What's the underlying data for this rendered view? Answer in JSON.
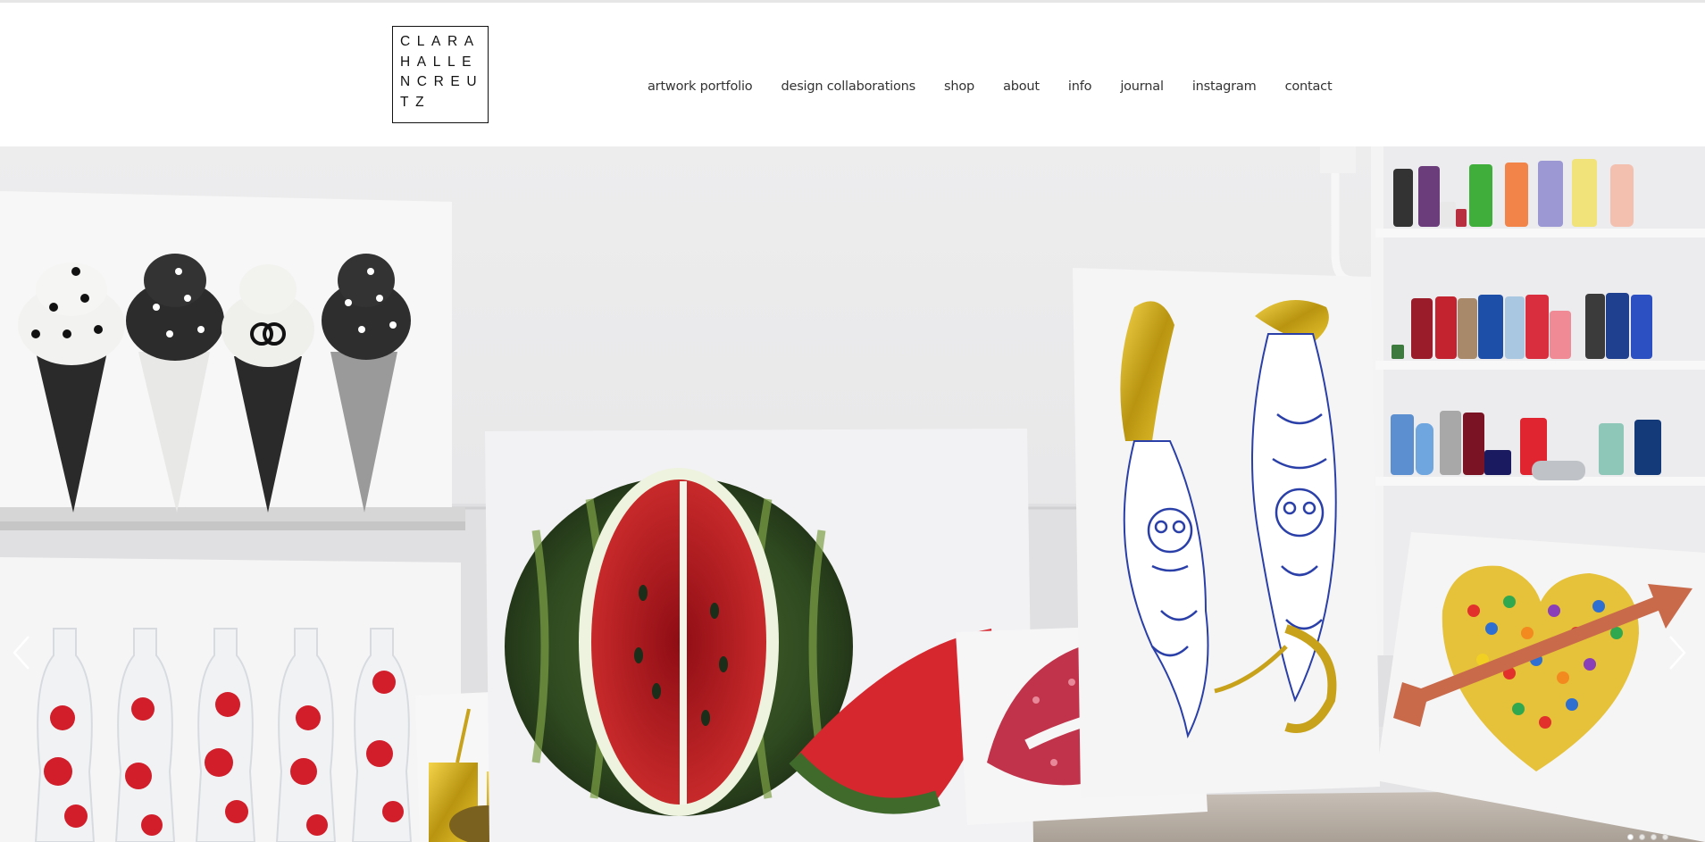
{
  "logo": {
    "lines": [
      "CLARA",
      "HALLE",
      "NCREU",
      "TZ"
    ]
  },
  "nav": {
    "items": [
      {
        "label": "artwork portfolio"
      },
      {
        "label": "design collaborations"
      },
      {
        "label": "shop"
      },
      {
        "label": "about"
      },
      {
        "label": "info"
      },
      {
        "label": "journal"
      },
      {
        "label": "instagram"
      },
      {
        "label": "contact"
      }
    ]
  },
  "slider": {
    "prev_icon": "chevron-left-icon",
    "next_icon": "chevron-right-icon",
    "current_slide": 1,
    "slide_count": 4
  },
  "colors": {
    "background": "#ffffff",
    "nav_text": "#333333",
    "wall": "#e9e9ea",
    "floor": "#b8afa6"
  }
}
